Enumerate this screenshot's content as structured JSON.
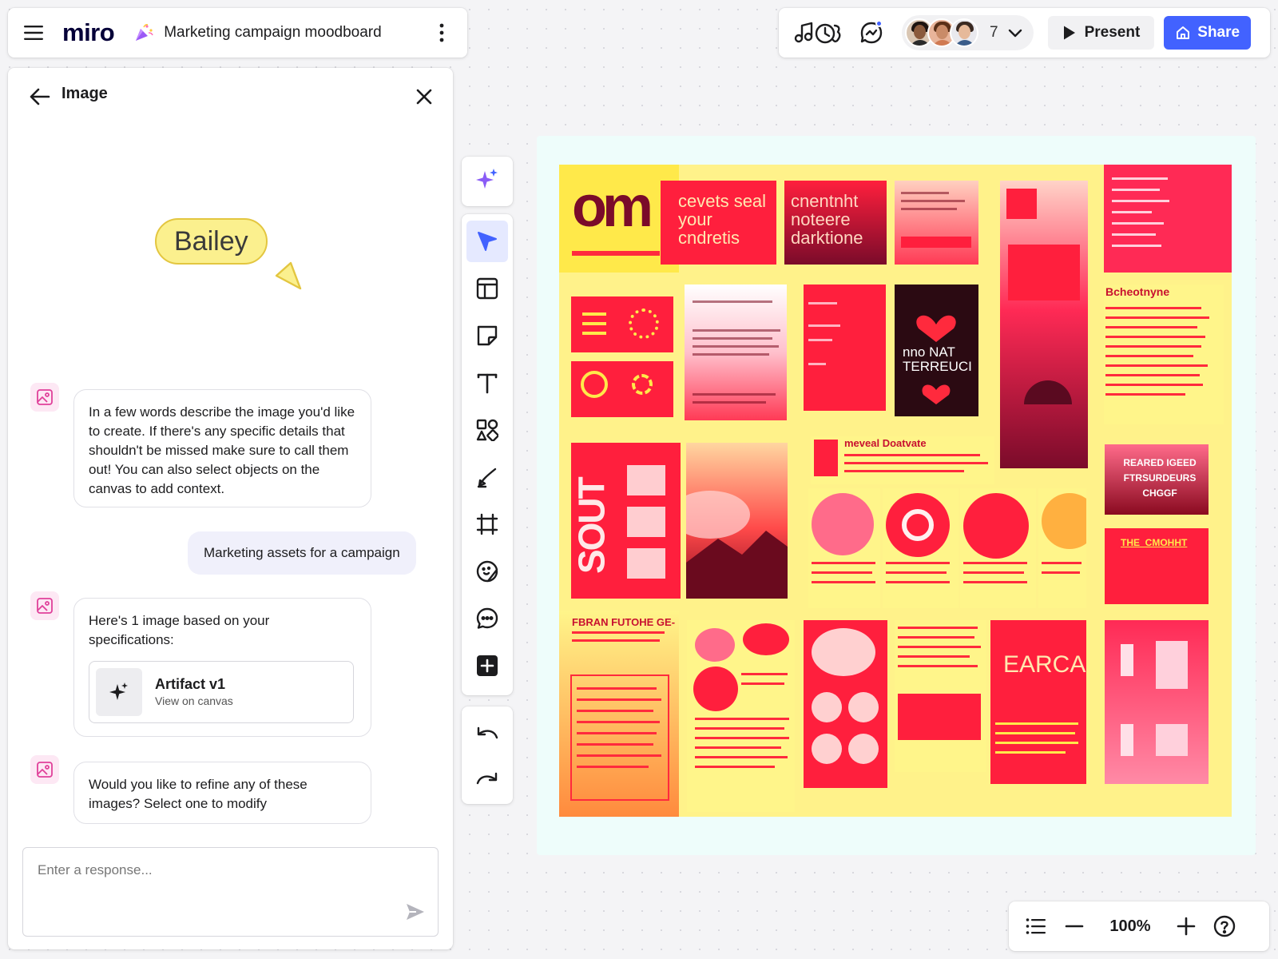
{
  "app": {
    "logo": "miro",
    "board_title": "Marketing campaign moodboard"
  },
  "header": {
    "collaborator_count": "7",
    "present_label": "Present",
    "share_label": "Share",
    "accent_color": "#4262ff"
  },
  "panel": {
    "title": "Image",
    "cursor_name": "Bailey",
    "cursor_color": "#fbf08e",
    "messages": [
      {
        "role": "assistant",
        "text": "In a few words describe the image you'd like to create. If there's any specific details that shouldn't be missed make sure to call them  out! You can also select objects on the canvas to add context."
      },
      {
        "role": "user",
        "text": "Marketing assets for a campaign"
      },
      {
        "role": "assistant",
        "text": "Here's 1 image based on your specifications:"
      },
      {
        "role": "assistant",
        "text": "Would you like to refine any of these images? Select one to modify"
      }
    ],
    "artifact": {
      "title": "Artifact v1",
      "subtitle": "View on canvas"
    },
    "response_placeholder": "Enter a response..."
  },
  "toolbar": {
    "tools": [
      "ai-sparkle-icon",
      "select-icon",
      "templates-icon",
      "sticky-note-icon",
      "text-icon",
      "shapes-icon",
      "pen-icon",
      "frame-icon",
      "stickers-icon",
      "comment-icon",
      "add-more-icon",
      "undo-icon",
      "redo-icon"
    ],
    "active_tool": "select"
  },
  "zoom": {
    "level": "100%"
  },
  "moodboard": {
    "palette": [
      "#ff1f3d",
      "#ff2a55",
      "#fff28a",
      "#ffd23f",
      "#7a0b2a",
      "#ff6b8a"
    ],
    "texts": {
      "t1": "om",
      "t2": "cevets seal your cndretis",
      "t3": "cnentnht noteere darktione",
      "t4": "nno NAT TERREUCI",
      "t5": "Bcheotnyne",
      "t6": "meveal Doatvate",
      "t7": "REARED IGEED FTRSURDEURS CHGGF",
      "t8": "THE_CMOHHT",
      "t9": "FBRAN FUTOHE GE-",
      "t10": "EARCA",
      "t11": "SOUT"
    }
  }
}
